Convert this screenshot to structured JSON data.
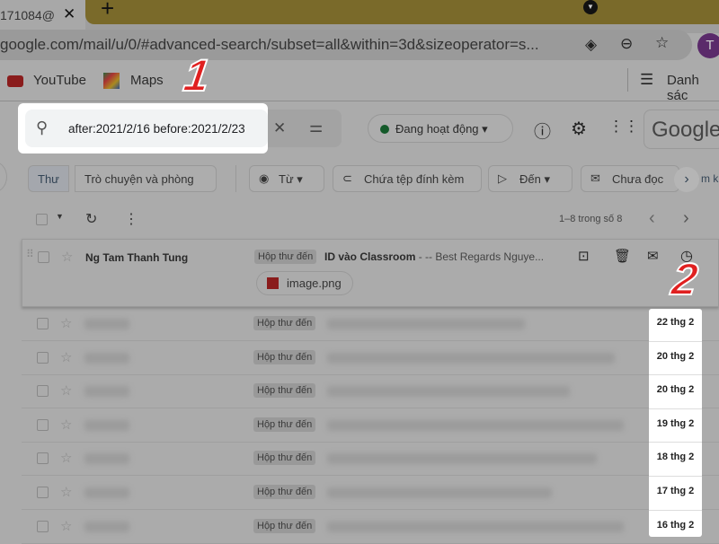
{
  "browser": {
    "tab_title": "171084@",
    "url": "google.com/mail/u/0/#advanced-search/subset=all&within=3d&sizeoperator=s...",
    "avatar": "T",
    "bookmarks": [
      {
        "label": "YouTube"
      },
      {
        "label": "Maps"
      }
    ],
    "reading_list": "Danh sác"
  },
  "search": {
    "query": "after:2021/2/16 before:2021/2/23"
  },
  "header": {
    "status": "Đang hoạt động",
    "logo": "Google"
  },
  "filters": {
    "tabs": [
      "Thư",
      "Trò chuyện và phòng"
    ],
    "chips": [
      "Từ",
      "Chứa tệp đính kèm",
      "Đến",
      "Chưa đọc"
    ],
    "more": "m k"
  },
  "toolbar": {
    "pagination": "1–8 trong số 8"
  },
  "expanded_email": {
    "sender": "Ng Tam Thanh Tung",
    "label": "Hộp thư đến",
    "subject": "ID vào Classroom",
    "snippet": " - -- Best Regards Nguye...",
    "attachment": "image.png"
  },
  "emails": [
    {
      "label": "Hộp thư đến",
      "date": "22 thg 2"
    },
    {
      "label": "Hộp thư đến",
      "date": "20 thg 2"
    },
    {
      "label": "Hộp thư đến",
      "date": "20 thg 2"
    },
    {
      "label": "Hộp thư đến",
      "date": "19 thg 2"
    },
    {
      "label": "Hộp thư đến",
      "date": "18 thg 2"
    },
    {
      "label": "Hộp thư đến",
      "date": "17 thg 2"
    },
    {
      "label": "Hộp thư đến",
      "date": "16 thg 2"
    }
  ],
  "annotations": [
    "1",
    "2"
  ],
  "colors": {
    "highlight": "#ffffff",
    "annotation": "#e02020",
    "status_dot": "#1e8e3e"
  }
}
